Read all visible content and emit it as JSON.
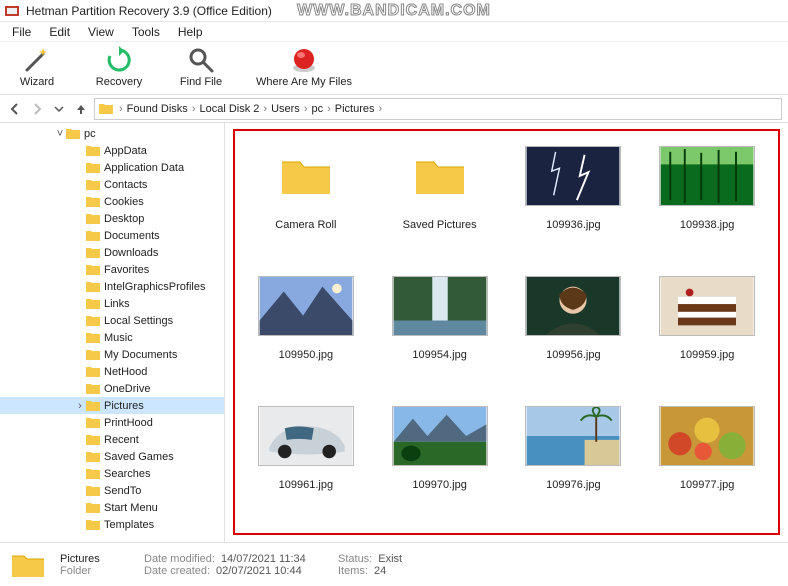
{
  "app": {
    "title": "Hetman Partition Recovery 3.9 (Office Edition)",
    "watermark": "WWW.BANDICAM.COM"
  },
  "menu": [
    "File",
    "Edit",
    "View",
    "Tools",
    "Help"
  ],
  "toolbar": [
    {
      "id": "wizard",
      "label": "Wizard"
    },
    {
      "id": "recovery",
      "label": "Recovery"
    },
    {
      "id": "findfile",
      "label": "Find File"
    },
    {
      "id": "wheremy",
      "label": "Where Are My Files"
    }
  ],
  "breadcrumb": [
    "Found Disks",
    "Local Disk 2",
    "Users",
    "pc",
    "Pictures"
  ],
  "tree": {
    "root": "pc",
    "selected": "Pictures",
    "items": [
      "AppData",
      "Application Data",
      "Contacts",
      "Cookies",
      "Desktop",
      "Documents",
      "Downloads",
      "Favorites",
      "IntelGraphicsProfiles",
      "Links",
      "Local Settings",
      "Music",
      "My Documents",
      "NetHood",
      "OneDrive",
      "Pictures",
      "PrintHood",
      "Recent",
      "Saved Games",
      "Searches",
      "SendTo",
      "Start Menu",
      "Templates"
    ]
  },
  "items": [
    {
      "type": "folder",
      "label": "Camera Roll"
    },
    {
      "type": "folder",
      "label": "Saved Pictures"
    },
    {
      "type": "image",
      "label": "109936.jpg",
      "thumb": "lightning"
    },
    {
      "type": "image",
      "label": "109938.jpg",
      "thumb": "forest"
    },
    {
      "type": "image",
      "label": "109950.jpg",
      "thumb": "mountain-sky"
    },
    {
      "type": "image",
      "label": "109954.jpg",
      "thumb": "waterfall"
    },
    {
      "type": "image",
      "label": "109956.jpg",
      "thumb": "portrait"
    },
    {
      "type": "image",
      "label": "109959.jpg",
      "thumb": "cake"
    },
    {
      "type": "image",
      "label": "109961.jpg",
      "thumb": "car"
    },
    {
      "type": "image",
      "label": "109970.jpg",
      "thumb": "mountain-green"
    },
    {
      "type": "image",
      "label": "109976.jpg",
      "thumb": "beach"
    },
    {
      "type": "image",
      "label": "109977.jpg",
      "thumb": "food"
    }
  ],
  "status": {
    "name": "Pictures",
    "kind": "Folder",
    "modified_label": "Date modified:",
    "modified": "14/07/2021 11:34",
    "created_label": "Date created:",
    "created": "02/07/2021 10:44",
    "status_label": "Status:",
    "status": "Exist",
    "items_label": "Items:",
    "items": "24"
  }
}
